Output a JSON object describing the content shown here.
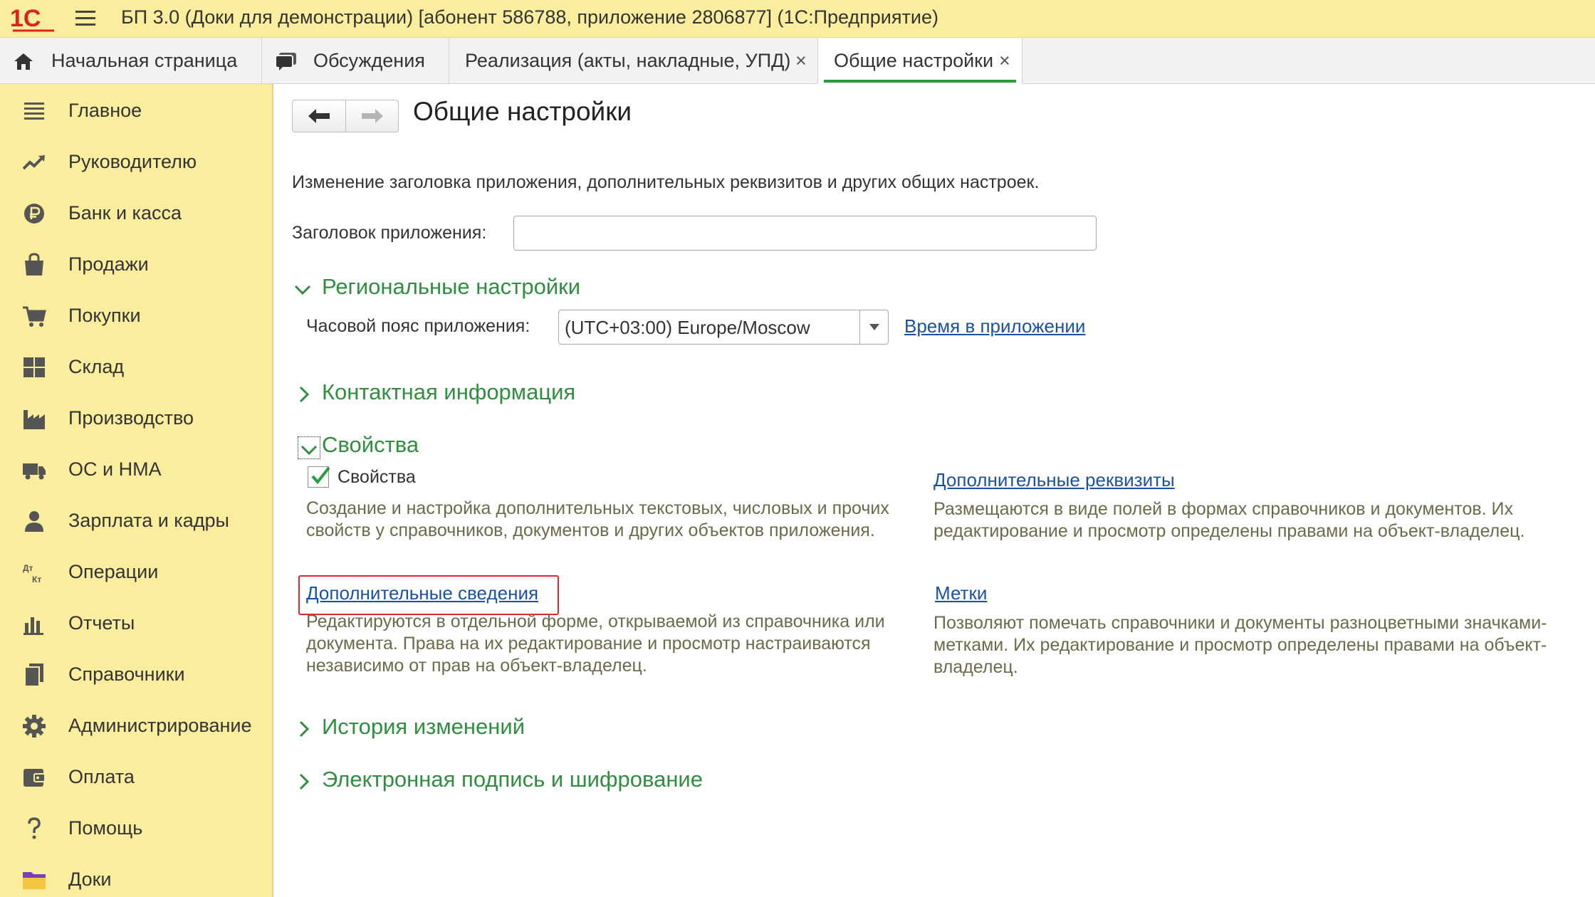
{
  "window": {
    "title": "БП 3.0 (Доки для демонстрации) [абонент 586788, приложение 2806877]  (1С:Предприятие)",
    "logo_text": "1С"
  },
  "tabs": [
    {
      "label": "Начальная страница",
      "icon": "home-icon"
    },
    {
      "label": "Обсуждения",
      "icon": "chat-icon"
    },
    {
      "label": "Реализация (акты, накладные, УПД)",
      "closable": true
    },
    {
      "label": "Общие настройки",
      "closable": true,
      "active": true
    }
  ],
  "tab_close": "×",
  "sidebar": {
    "items": [
      {
        "label": "Главное",
        "icon": "menu-lines-icon"
      },
      {
        "label": "Руководителю",
        "icon": "trend-up-icon"
      },
      {
        "label": "Банк и касса",
        "icon": "ruble-coin-icon"
      },
      {
        "label": "Продажи",
        "icon": "shopping-bag-icon"
      },
      {
        "label": "Покупки",
        "icon": "cart-icon"
      },
      {
        "label": "Склад",
        "icon": "warehouse-icon"
      },
      {
        "label": "Производство",
        "icon": "factory-icon"
      },
      {
        "label": "ОС и НМА",
        "icon": "truck-icon"
      },
      {
        "label": "Зарплата и кадры",
        "icon": "person-icon"
      },
      {
        "label": "Операции",
        "icon": "dt-kt-icon"
      },
      {
        "label": "Отчеты",
        "icon": "bar-chart-icon"
      },
      {
        "label": "Справочники",
        "icon": "books-icon"
      },
      {
        "label": "Администрирование",
        "icon": "gear-icon"
      },
      {
        "label": "Оплата",
        "icon": "wallet-icon"
      },
      {
        "label": "Помощь",
        "icon": "question-icon"
      },
      {
        "label": "Доки",
        "icon": "folder-icon"
      }
    ],
    "dtkt": {
      "dt": "Дт",
      "kt": "Кт"
    }
  },
  "form": {
    "title": "Общие настройки",
    "description": "Изменение заголовка приложения, дополнительных реквизитов и других общих настроек.",
    "app_title_label": "Заголовок приложения:",
    "app_title_value": ""
  },
  "regional": {
    "title": "Региональные настройки",
    "expanded": true,
    "timezone_label": "Часовой пояс приложения:",
    "timezone_value": "(UTC+03:00) Europe/Moscow",
    "time_link": "Время в приложении"
  },
  "contact": {
    "title": "Контактная информация",
    "expanded": false
  },
  "properties": {
    "title": "Свойства",
    "expanded": true,
    "checkbox_label": "Свойства",
    "checkbox_checked": true,
    "checkbox_desc": "Создание и настройка дополнительных текстовых, числовых и прочих свойств у справочников, документов и других объектов приложения.",
    "add_info_link": "Дополнительные сведения",
    "add_info_desc": "Редактируются в отдельной форме, открываемой из справочника или документа. Права на их редактирование и просмотр настраиваются независимо от прав на объект-владелец.",
    "add_req_link": "Дополнительные реквизиты",
    "add_req_desc": "Размещаются в виде полей в формах справочников и документов. Их редактирование и просмотр определены правами на объект-владелец.",
    "tags_link": "Метки",
    "tags_desc": "Позволяют помечать справочники и документы разноцветными значками-метками. Их редактирование и просмотр определены правами на объект-владелец."
  },
  "history": {
    "title": "История изменений",
    "expanded": false
  },
  "esign": {
    "title": "Электронная подпись и шифрование",
    "expanded": false
  },
  "colors": {
    "titlebar": "#fbed9e",
    "sidebar": "#fbed9e",
    "section_green": "#2f8f3f",
    "link_blue": "#1a52a3",
    "highlight_red": "#e0282e"
  }
}
